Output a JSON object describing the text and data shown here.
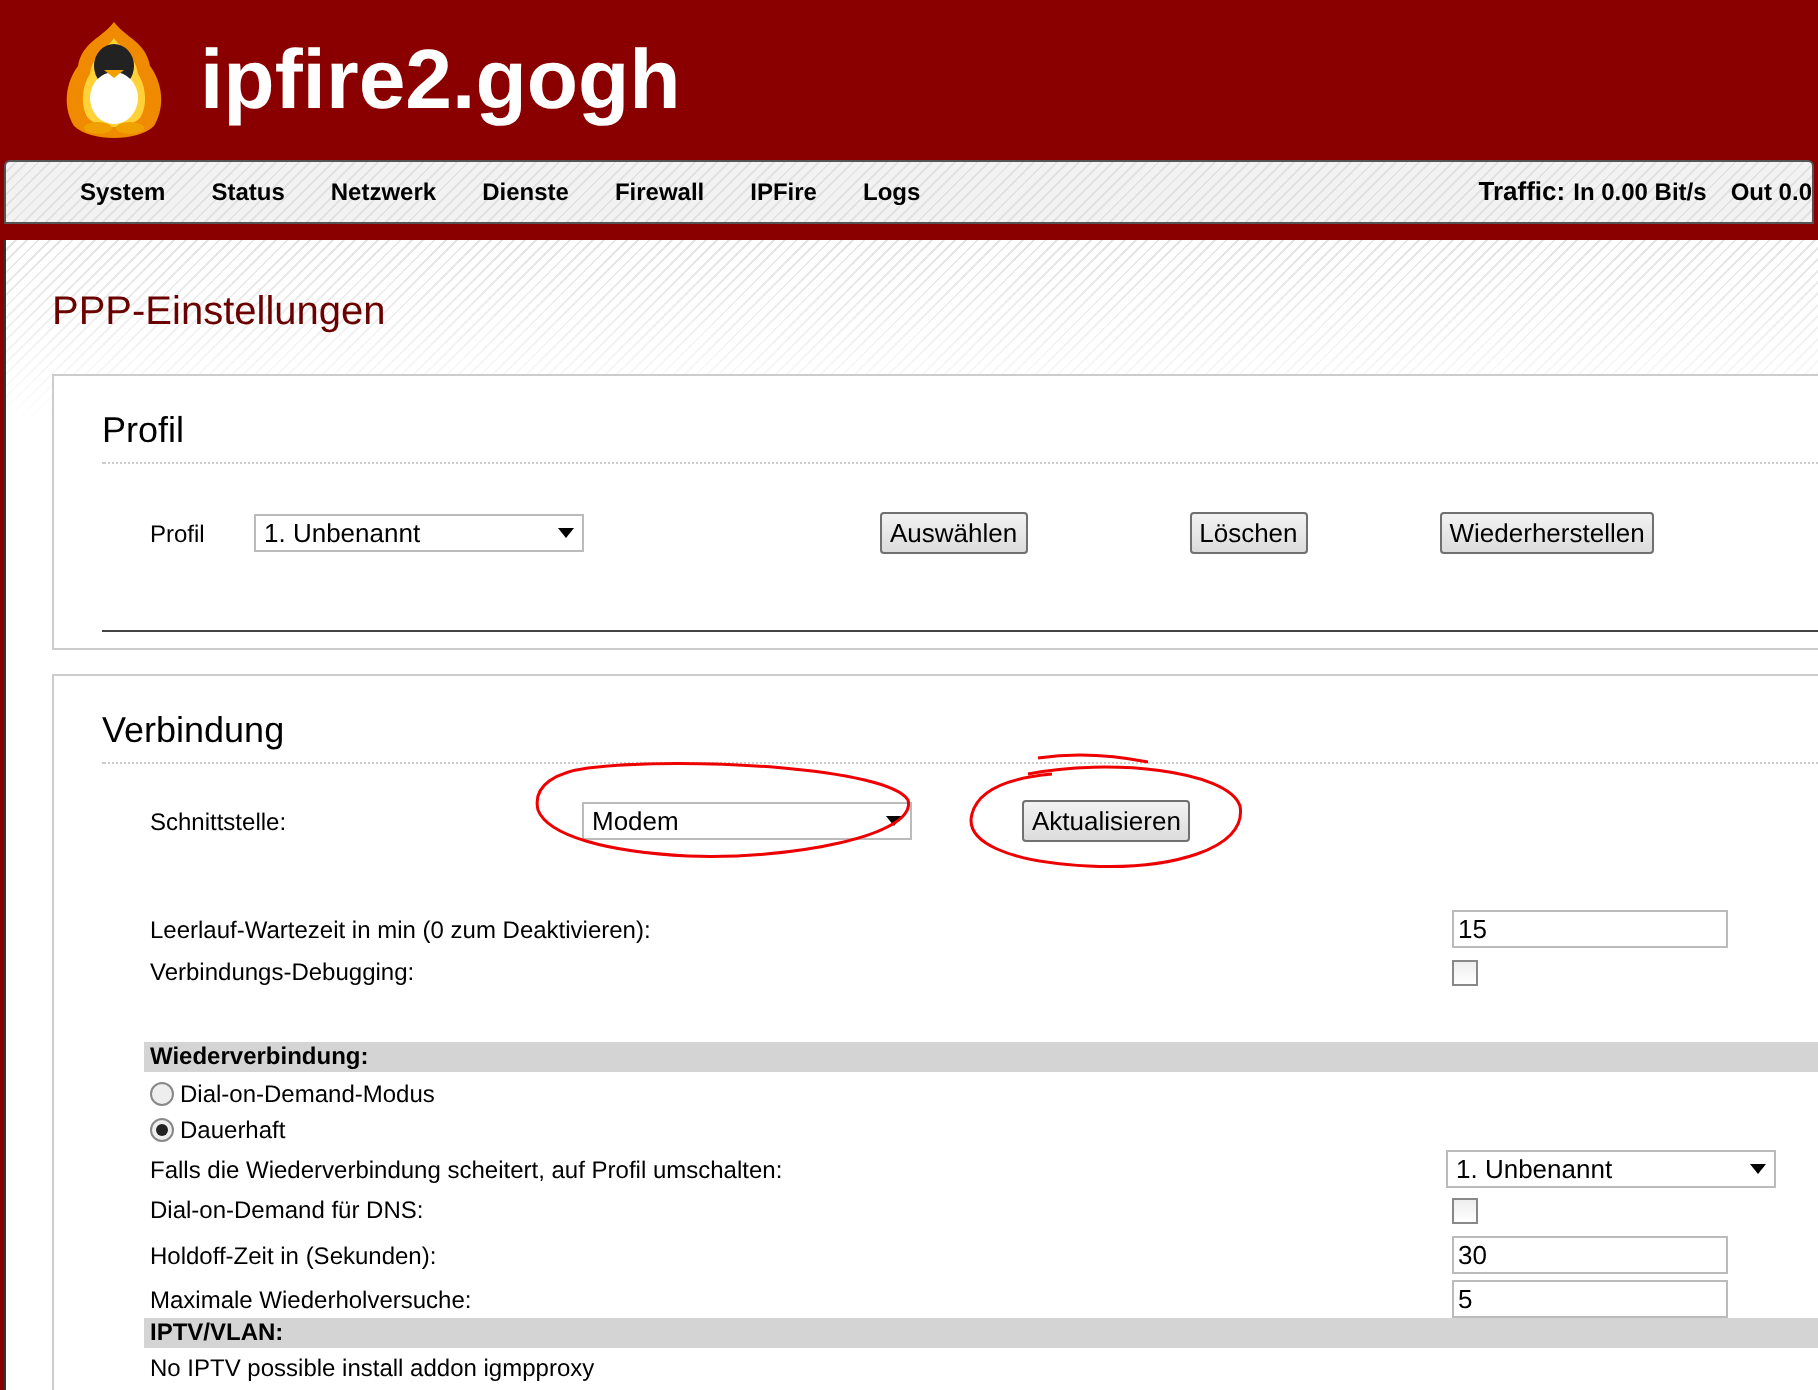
{
  "header": {
    "title": "ipfire2.gogh"
  },
  "nav": {
    "items": [
      {
        "label": "System"
      },
      {
        "label": "Status"
      },
      {
        "label": "Netzwerk"
      },
      {
        "label": "Dienste"
      },
      {
        "label": "Firewall"
      },
      {
        "label": "IPFire"
      },
      {
        "label": "Logs"
      }
    ],
    "traffic": {
      "label": "Traffic:",
      "in": "In 0.00 Bit/s",
      "out": "Out 0.0"
    }
  },
  "page_title": "PPP-Einstellungen",
  "profile_section": {
    "title": "Profil",
    "label": "Profil",
    "select": "1. Unbenannt",
    "buttons": [
      "Auswählen",
      "Löschen",
      "Wiederherstellen"
    ]
  },
  "connection_section": {
    "title": "Verbindung",
    "interface_label": "Schnittstelle:",
    "interface": "Modem",
    "refresh_button": "Aktualisieren",
    "idle_label": "Leerlauf-Wartezeit in min (0 zum Deaktivieren):",
    "idle_value": "15",
    "debug_label": "Verbindungs-Debugging:",
    "debug_checked": false,
    "reconnect_heading": "Wiederverbindung:",
    "reconnect_modes": [
      {
        "label": "Dial-on-Demand-Modus",
        "selected": false
      },
      {
        "label": "Dauerhaft",
        "selected": true
      }
    ],
    "fallback_label": "Falls die Wiederverbindung scheitert, auf Profil umschalten:",
    "fallback_value": "1. Unbenannt",
    "dod_dns_label": "Dial-on-Demand für DNS:",
    "dod_dns_checked": false,
    "holdoff_label": "Holdoff-Zeit in (Sekunden):",
    "holdoff_value": "30",
    "retries_label": "Maximale Wiederholversuche:",
    "retries_value": "5",
    "iptv_heading": "IPTV/VLAN:",
    "iptv_note": "No IPTV possible install addon igmpproxy"
  }
}
